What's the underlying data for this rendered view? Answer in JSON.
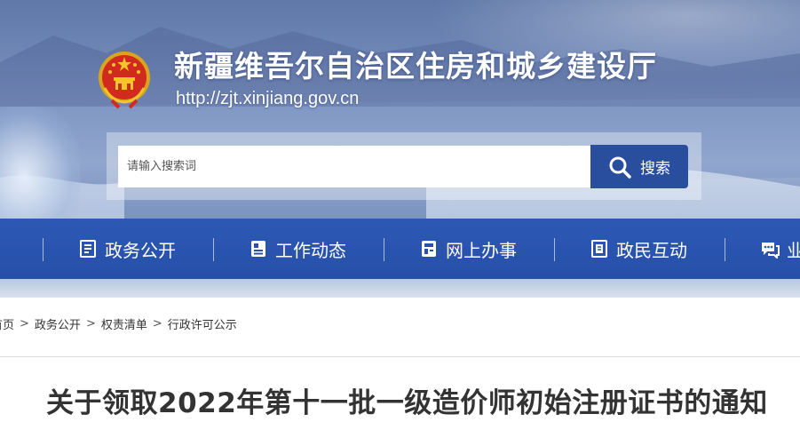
{
  "header": {
    "title": "新疆维吾尔自治区住房和城乡建设厅",
    "url": "http://zjt.xinjiang.gov.cn"
  },
  "search": {
    "placeholder": "请输入搜索词",
    "button_label": "搜索"
  },
  "nav": {
    "items": [
      {
        "label": "政务公开",
        "icon": "document-list-icon"
      },
      {
        "label": "工作动态",
        "icon": "news-icon"
      },
      {
        "label": "网上办事",
        "icon": "service-icon"
      },
      {
        "label": "政民互动",
        "icon": "interaction-icon"
      },
      {
        "label": "业",
        "icon": "chat-icon"
      }
    ]
  },
  "breadcrumb": {
    "items": [
      "首页",
      "政务公开",
      "权责清单",
      "行政许可公示"
    ]
  },
  "article": {
    "title": "关于领取2022年第十一批一级造价师初始注册证书的通知"
  },
  "colors": {
    "nav_bg": "#2a52ad",
    "search_button": "#2a4e9e",
    "title_text": "#333333"
  }
}
